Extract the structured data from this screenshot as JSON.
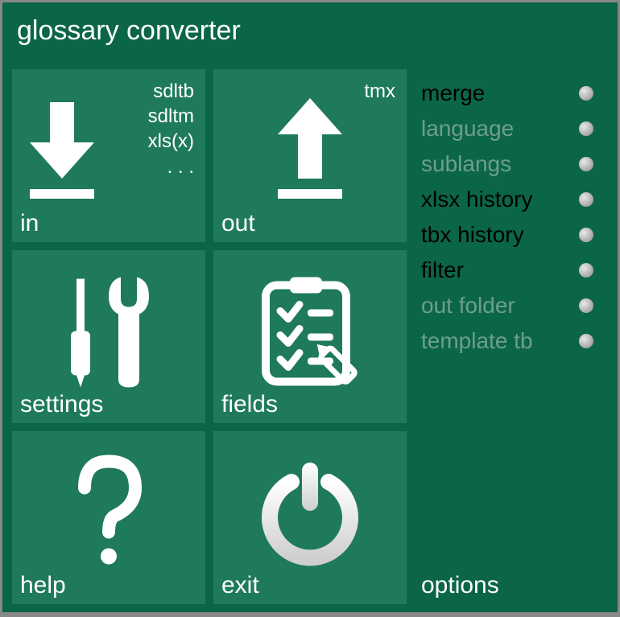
{
  "title": "glossary converter",
  "tiles": {
    "in": {
      "label": "in",
      "formats": [
        "sdltb",
        "sdltm",
        "xls(x)",
        ". . ."
      ]
    },
    "out": {
      "label": "out",
      "format": "tmx"
    },
    "settings": {
      "label": "settings"
    },
    "fields": {
      "label": "fields"
    },
    "help": {
      "label": "help"
    },
    "exit": {
      "label": "exit"
    }
  },
  "sidebar": {
    "label": "options",
    "items": [
      {
        "label": "merge",
        "enabled": true
      },
      {
        "label": "language",
        "enabled": false
      },
      {
        "label": "sublangs",
        "enabled": false
      },
      {
        "label": "xlsx history",
        "enabled": true
      },
      {
        "label": "tbx history",
        "enabled": true
      },
      {
        "label": "filter",
        "enabled": true
      },
      {
        "label": "out folder",
        "enabled": false
      },
      {
        "label": "template tb",
        "enabled": false
      }
    ]
  }
}
